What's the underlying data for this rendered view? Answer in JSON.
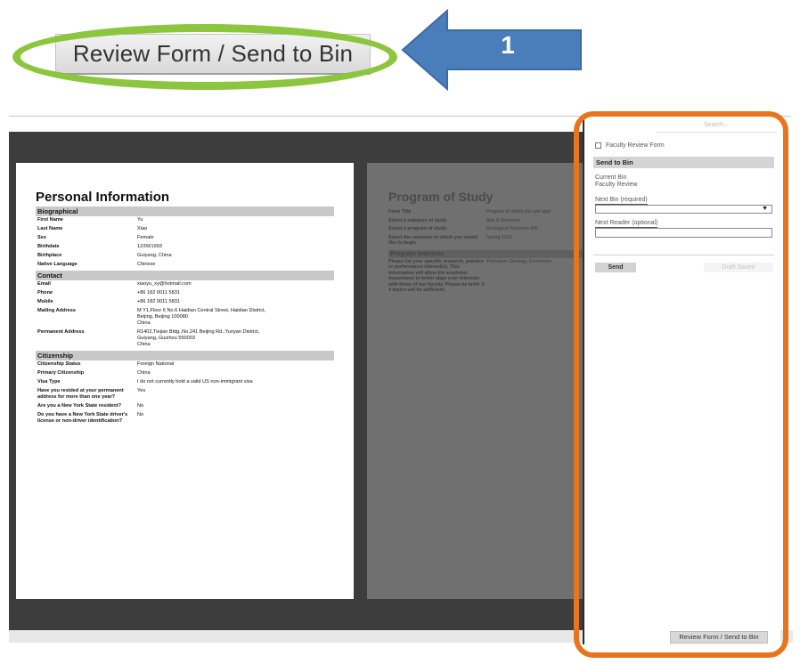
{
  "callout": {
    "button_label": "Review Form / Send to Bin",
    "step_number": "1",
    "colors": {
      "ellipse": "#8cc63e",
      "arrow": "#4a7ebb",
      "highlight_box": "#e8741e"
    }
  },
  "left_page": {
    "title": "Personal Information",
    "sections": [
      {
        "header": "Biographical",
        "rows": [
          {
            "label": "First Name",
            "value": "Yu"
          },
          {
            "label": "Last Name",
            "value": "Xiao"
          },
          {
            "label": "Sex",
            "value": "Female"
          },
          {
            "label": "Birthdate",
            "value": "12/09/1993"
          },
          {
            "label": "Birthplace",
            "value": "Guiyang, China"
          },
          {
            "label": "Native Language",
            "value": "Chinese"
          }
        ]
      },
      {
        "header": "Contact",
        "rows": [
          {
            "label": "Email",
            "value": "xiaoyu_xy@hotmail.com"
          },
          {
            "label": "Phone",
            "value": "+86 182 0011 5831"
          },
          {
            "label": "Mobile",
            "value": "+86 182 0011 5831"
          },
          {
            "label": "Mailing Address",
            "value": "M Y1,Floor 6 No.6 Haidian Central Street, Haidian District,\nBeijing, Beijing 100080\nChina"
          },
          {
            "label": "Permanent Address",
            "value": "R1402,Tiejian Bldg.,No.241 Beijing Rd.,Yunyan District,\nGuiyang, Guizhou 550003\nChina"
          }
        ]
      },
      {
        "header": "Citizenship",
        "rows": [
          {
            "label": "Citizenship Status",
            "value": "Foreign National"
          },
          {
            "label": "Primary Citizenship",
            "value": "China"
          },
          {
            "label": "Visa Type",
            "value": "I do not currently hold a valid US non-immigrant visa"
          },
          {
            "label": "Have you resided at your permanent address for more than one year?",
            "value": "Yes"
          },
          {
            "label": "Are you a New York State resident?",
            "value": "No"
          },
          {
            "label": "Do you have a New York State driver's license or non-driver identification?",
            "value": "No"
          }
        ]
      }
    ]
  },
  "right_page": {
    "title": "Program of Study",
    "rows": [
      {
        "label": "Form Title",
        "value": "Program to which you are appl"
      },
      {
        "label": "Select a category of study",
        "value": "Arts & Sciences"
      },
      {
        "label": "Select a program of study",
        "value": "Geological Sciences MS"
      },
      {
        "label": "Select the semester in which you would like to begin",
        "value": "Spring 2016"
      }
    ],
    "section_header": "Program Interests",
    "interest_label": "Please list your specific research, practice or performance interest(s). This information will allow the academic department to better align your interests with those of our faculty. Please be brief: 3-4 topics will be sufficient.",
    "interest_value": "Petroleum Geology, Environme"
  },
  "panel": {
    "search_placeholder": "Search...",
    "checkbox_label": "Faculty Review Form",
    "section_header": "Send to Bin",
    "current_bin_label": "Current Bin",
    "current_bin_value": "Faculty Review",
    "next_bin_label": "Next Bin (required)",
    "next_reader_label": "Next Reader (optional)",
    "send_label": "Send",
    "draft_label": "Draft Saved",
    "footer_button_label": "Review Form / Send to Bin"
  }
}
